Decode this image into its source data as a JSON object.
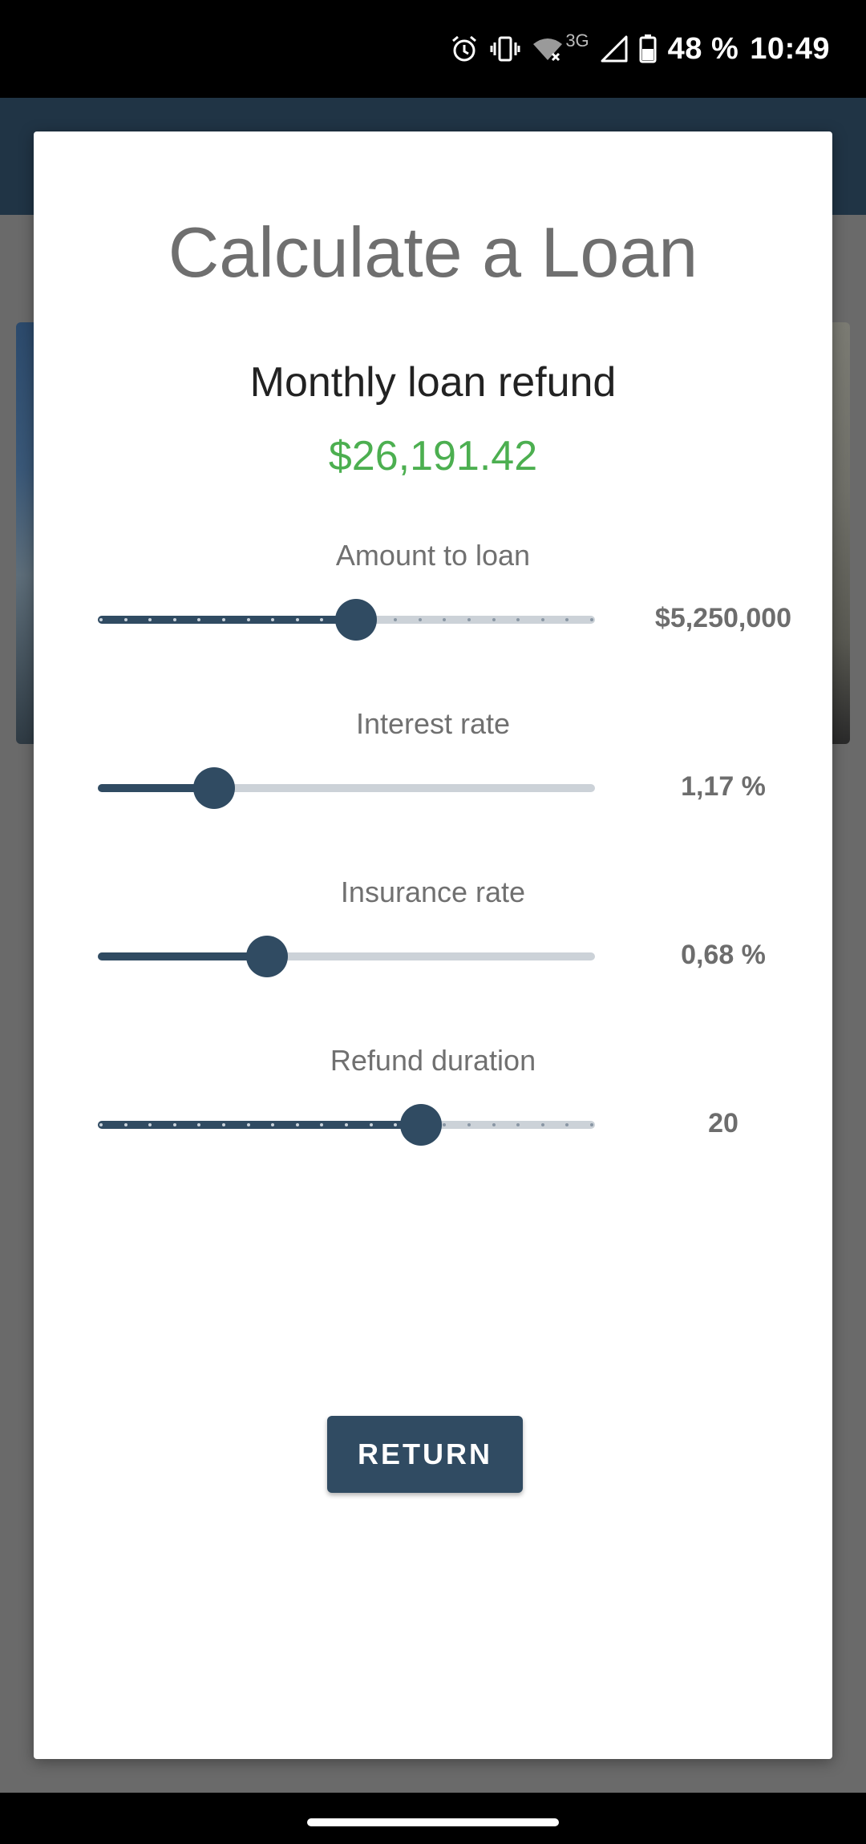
{
  "status_bar": {
    "battery": "48 %",
    "time": "10:49",
    "network": "3G",
    "icons": [
      "alarm-icon",
      "vibrate-icon",
      "wifi-off-icon",
      "signal-icon",
      "battery-icon"
    ]
  },
  "dialog": {
    "title": "Calculate a Loan",
    "subtitle": "Monthly loan refund",
    "monthly_amount": "$26,191.42",
    "sliders": [
      {
        "label": "Amount to loan",
        "value": "$5,250,000",
        "fraction": 0.52,
        "discrete": true,
        "ticks": 20
      },
      {
        "label": "Interest rate",
        "value": "1,17 %",
        "fraction": 0.234,
        "discrete": false
      },
      {
        "label": "Insurance rate",
        "value": "0,68 %",
        "fraction": 0.34,
        "discrete": false
      },
      {
        "label": "Refund duration",
        "value": "20",
        "fraction": 0.65,
        "discrete": true,
        "ticks": 20
      }
    ],
    "return_label": "RETURN"
  },
  "colors": {
    "accent": "#304b62",
    "amount_green": "#4caf50",
    "app_bar": "#203445"
  }
}
